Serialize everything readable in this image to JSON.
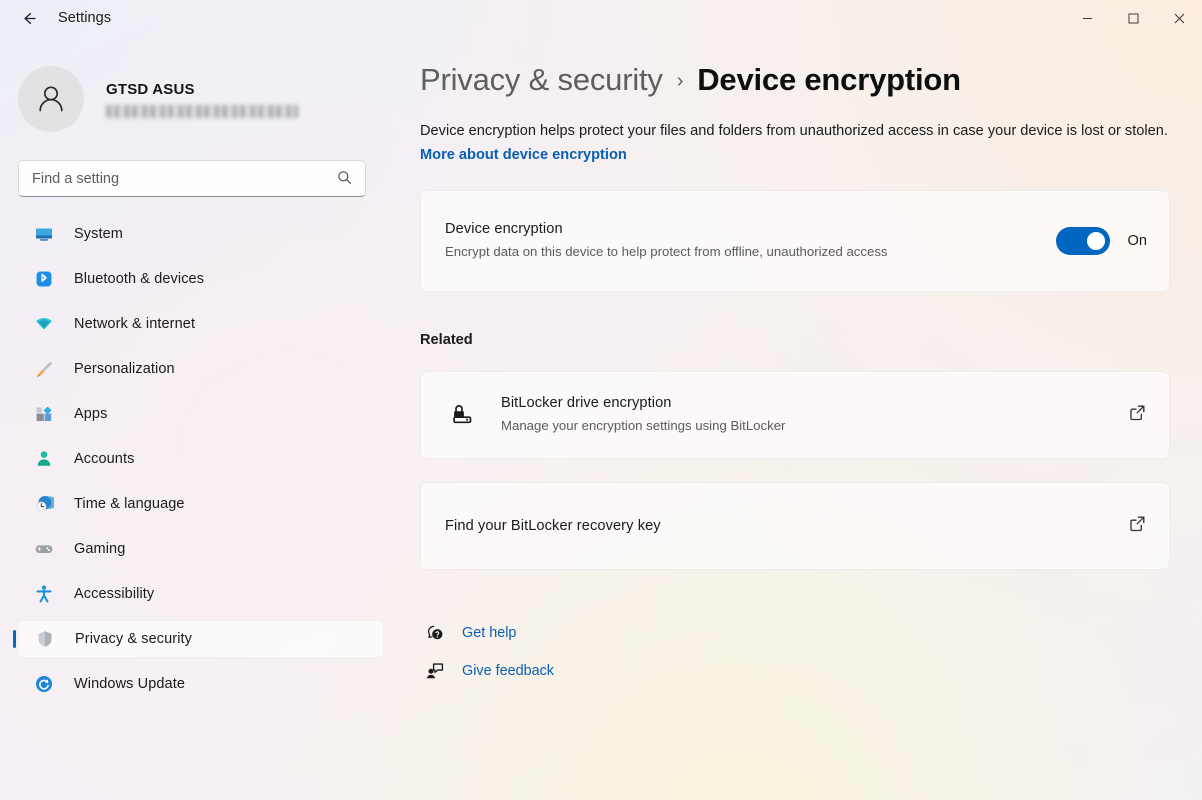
{
  "window": {
    "title": "Settings",
    "back_icon": "back-arrow-icon",
    "minimize_label": "─",
    "maximize_label": "□",
    "close_label": "✕"
  },
  "sidebar": {
    "account": {
      "name": "GTSD ASUS",
      "email_redacted": true,
      "avatar_icon": "person-avatar-icon"
    },
    "search": {
      "placeholder": "Find a setting",
      "value": "",
      "icon": "search-icon"
    },
    "items": [
      {
        "label": "System",
        "icon": "system-monitor-icon",
        "selected": false
      },
      {
        "label": "Bluetooth & devices",
        "icon": "bluetooth-icon",
        "selected": false
      },
      {
        "label": "Network & internet",
        "icon": "wifi-icon",
        "selected": false
      },
      {
        "label": "Personalization",
        "icon": "paintbrush-icon",
        "selected": false
      },
      {
        "label": "Apps",
        "icon": "apps-grid-icon",
        "selected": false
      },
      {
        "label": "Accounts",
        "icon": "accounts-person-icon",
        "selected": false
      },
      {
        "label": "Time & language",
        "icon": "clock-globe-icon",
        "selected": false
      },
      {
        "label": "Gaming",
        "icon": "gamepad-icon",
        "selected": false
      },
      {
        "label": "Accessibility",
        "icon": "accessibility-icon",
        "selected": false
      },
      {
        "label": "Privacy & security",
        "icon": "shield-icon",
        "selected": true
      },
      {
        "label": "Windows Update",
        "icon": "windows-update-icon",
        "selected": false
      }
    ]
  },
  "main": {
    "breadcrumb": {
      "parent": "Privacy & security",
      "separator": "›",
      "current": "Device encryption"
    },
    "description": {
      "text": "Device encryption helps protect your files and folders from unauthorized access in case your device is lost or stolen. ",
      "link": "More about device encryption"
    },
    "device_encryption_card": {
      "title": "Device encryption",
      "subtitle": "Encrypt data on this device to help protect from offline, unauthorized access",
      "toggle_state": "On",
      "toggle_on": true
    },
    "related_heading": "Related",
    "related_items": [
      {
        "title": "BitLocker drive encryption",
        "subtitle": "Manage your encryption settings using BitLocker",
        "lead_icon": "bitlocker-drive-lock-icon",
        "trailing_icon": "external-link-icon"
      },
      {
        "title": "Find your BitLocker recovery key",
        "subtitle": "",
        "lead_icon": "",
        "trailing_icon": "external-link-icon"
      }
    ],
    "footer_links": [
      {
        "label": "Get help",
        "icon": "help-question-bubble-icon"
      },
      {
        "label": "Give feedback",
        "icon": "feedback-person-bubble-icon"
      }
    ]
  },
  "colors": {
    "accent": "#0067C0",
    "link": "#0A5FB4",
    "selected_bar": "#0C66C2"
  }
}
